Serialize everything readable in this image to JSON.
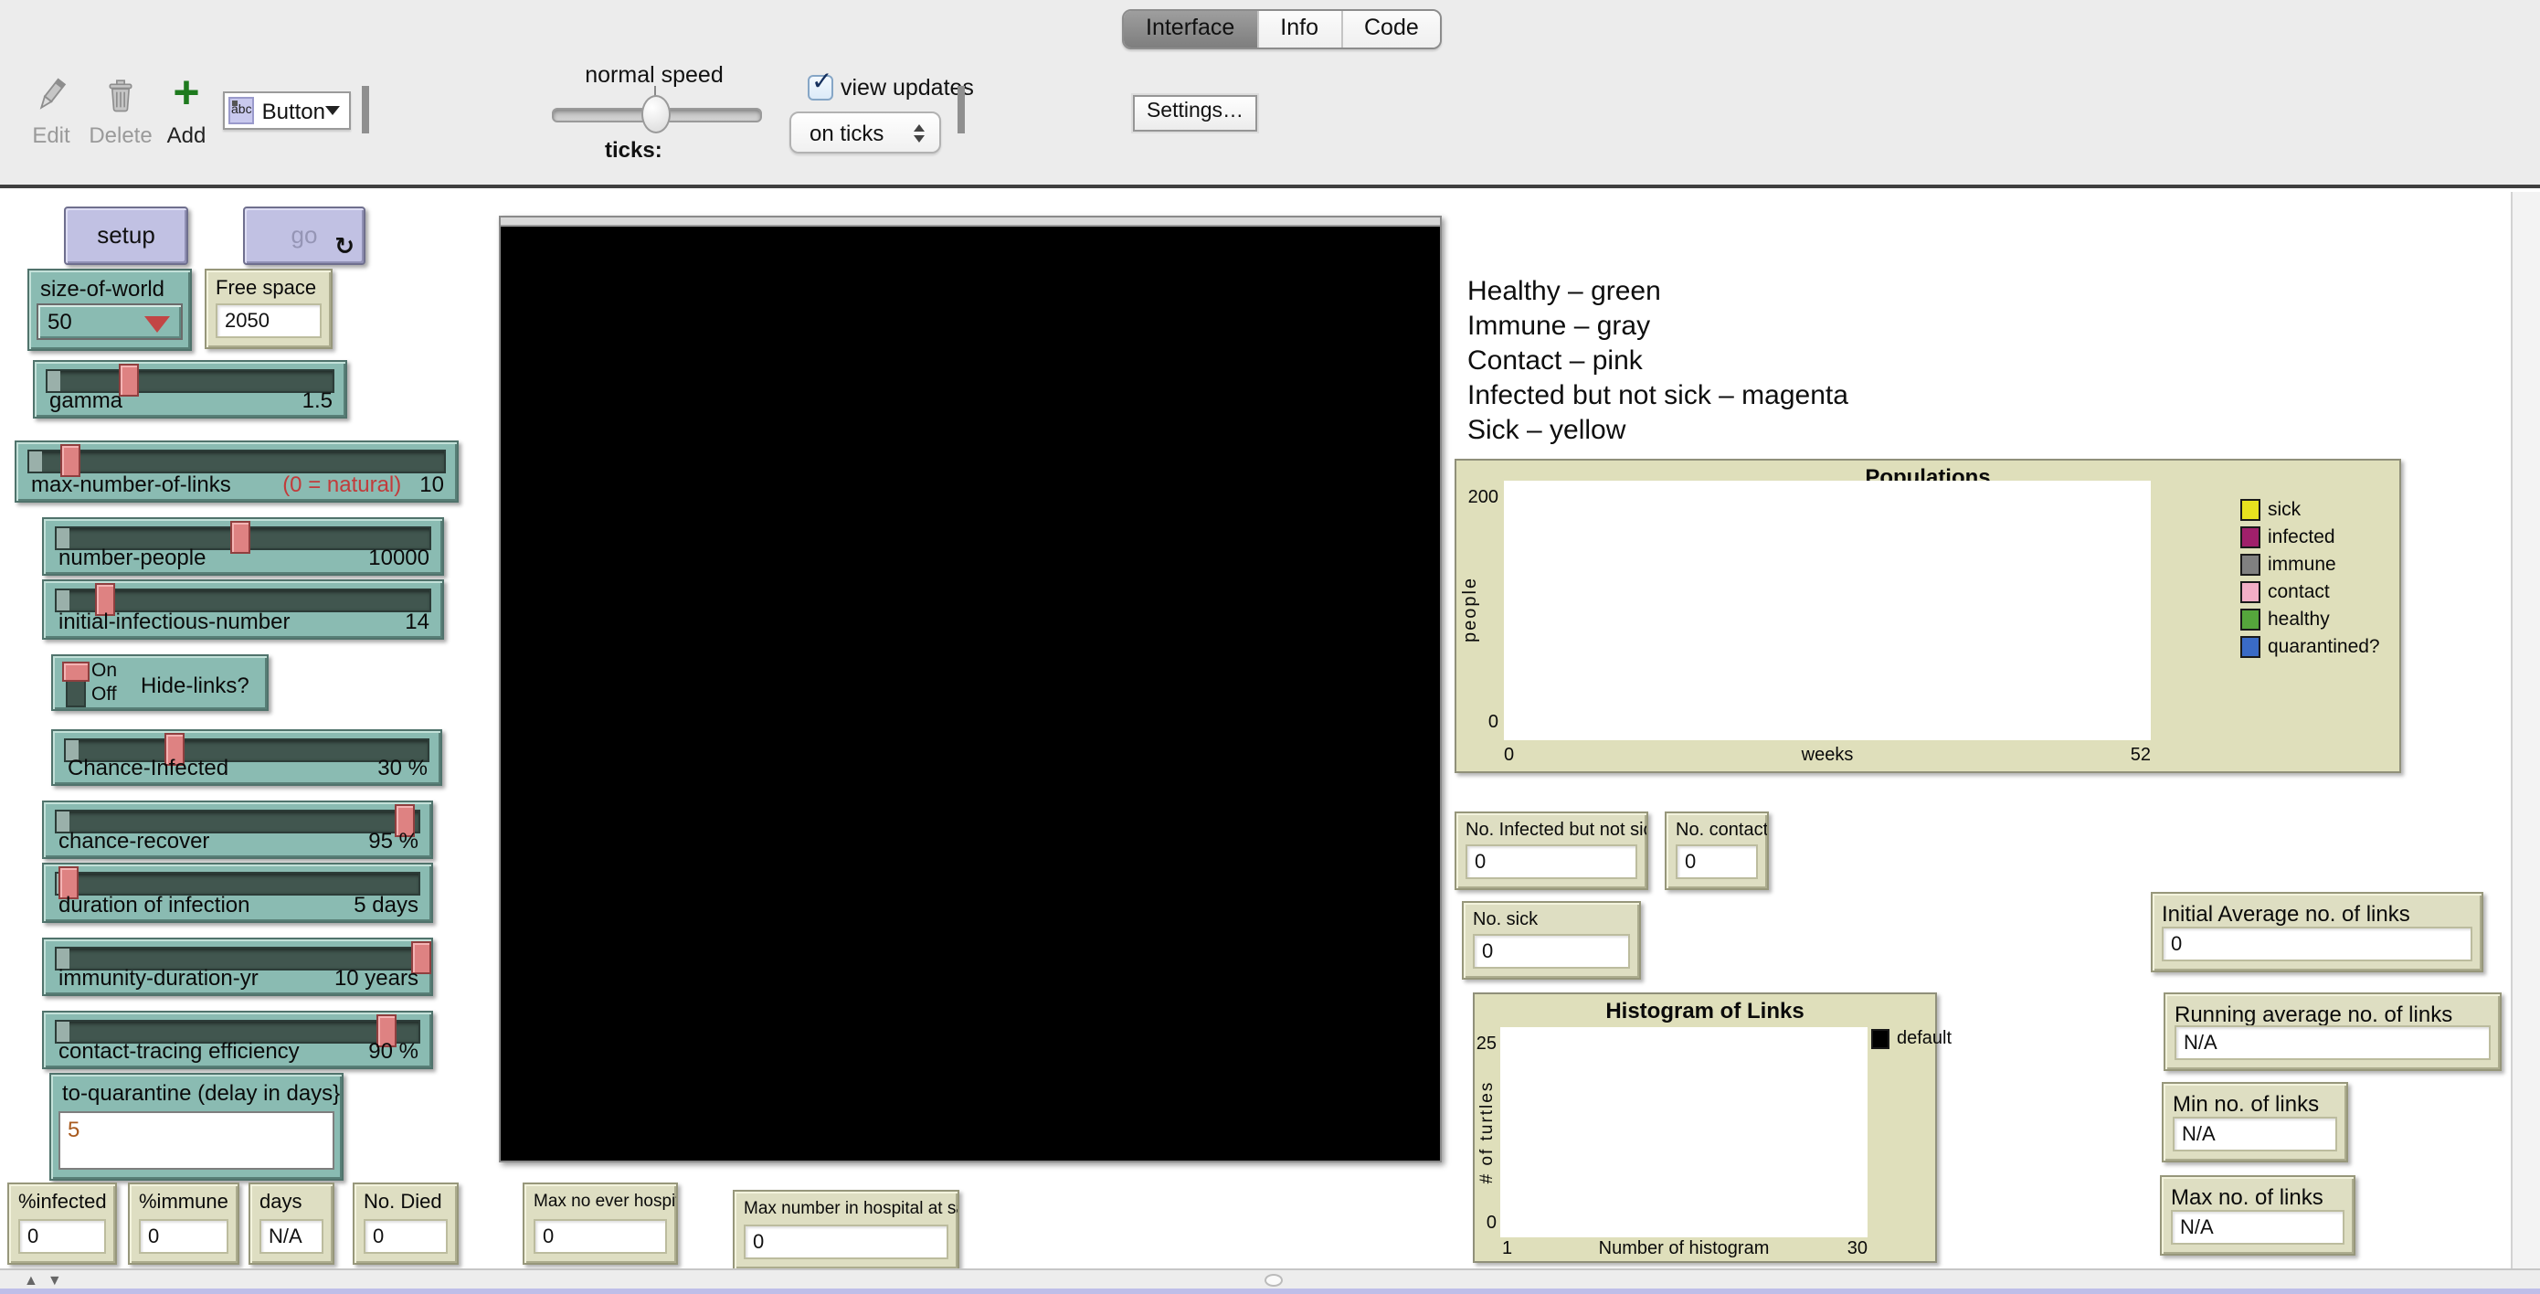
{
  "toolbar": {
    "tabs": [
      {
        "label": "Interface",
        "active": true
      },
      {
        "label": "Info",
        "active": false
      },
      {
        "label": "Code",
        "active": false
      }
    ],
    "edit_label": "Edit",
    "delete_label": "Delete",
    "add_label": "Add",
    "widget_chooser": {
      "icon_label": "abc",
      "value": "Button"
    },
    "speed_label": "normal speed",
    "ticks_label": "ticks:",
    "view_updates_label": "view updates",
    "view_updates_checked": "✓",
    "update_mode": {
      "value": "on ticks"
    },
    "settings_label": "Settings…"
  },
  "buttons": {
    "setup_label": "setup",
    "go_label": "go",
    "forever_glyph": "↻"
  },
  "chooser": {
    "label": "size-of-world",
    "value": "50"
  },
  "monitors_left": [
    {
      "label": "Free space",
      "value": "2050"
    }
  ],
  "sliders": [
    {
      "label": "gamma",
      "extra": "",
      "value": "1.5",
      "pos": 30
    },
    {
      "label": "max-number-of-links",
      "extra": "(0 = natural)",
      "value": "10",
      "pos": 12
    },
    {
      "label": "number-people",
      "extra": "",
      "value": "10000",
      "pos": 49
    },
    {
      "label": "initial-infectious-number",
      "extra": "",
      "value": "14",
      "pos": 15
    },
    {
      "label": "Chance-Infected",
      "extra": "",
      "value": "30 %",
      "pos": 31
    },
    {
      "label": "chance-recover",
      "extra": "",
      "value": "95 %",
      "pos": 93
    },
    {
      "label": "duration of infection",
      "extra": "",
      "value": "5 days",
      "pos": 6
    },
    {
      "label": "immunity-duration-yr",
      "extra": "",
      "value": "10 years",
      "pos": 97
    },
    {
      "label": "contact-tracing efficiency",
      "extra": "",
      "value": "90 %",
      "pos": 88
    }
  ],
  "switch": {
    "label": "Hide-links?",
    "on_label": "On",
    "off_label": "Off",
    "state": "On"
  },
  "input": {
    "label": "to-quarantine (delay in days}",
    "value": "5"
  },
  "notes": {
    "lines": [
      "Healthy – green",
      "Immune – gray",
      "Contact – pink",
      "Infected but not sick – magenta",
      "Sick – yellow"
    ]
  },
  "plots": {
    "populations": {
      "title": "Populations",
      "ylabel": "people",
      "xlabel": "weeks",
      "ymax": "200",
      "ymin": "0",
      "xmin": "0",
      "xmax": "52",
      "legend": [
        {
          "label": "sick",
          "color": "#E8E21F"
        },
        {
          "label": "infected",
          "color": "#A0206B"
        },
        {
          "label": "immune",
          "color": "#808080"
        },
        {
          "label": "contact",
          "color": "#F2AEC6"
        },
        {
          "label": "healthy",
          "color": "#55A63C"
        },
        {
          "label": "quarantined?",
          "color": "#3A6BC6"
        }
      ]
    },
    "histogram": {
      "title": "Histogram of Links",
      "ylabel": "# of turtles",
      "xlabel": "Number of histogram",
      "ymax": "25",
      "ymin": "0",
      "xmin": "1",
      "xmax": "30",
      "legend": [
        {
          "label": "default",
          "color": "#000000"
        }
      ]
    }
  },
  "monitors_right": [
    {
      "label": "No. Infected but not sick",
      "value": "0"
    },
    {
      "label": "No. contacts",
      "value": "0"
    },
    {
      "label": "No. sick",
      "value": "0"
    },
    {
      "label": "Initial Average no. of links",
      "value": "0"
    },
    {
      "label": "Running average no. of links",
      "value": "N/A"
    },
    {
      "label": "Min no. of links",
      "value": "N/A"
    },
    {
      "label": "Max no. of links",
      "value": "N/A"
    }
  ],
  "monitors_bottom": [
    {
      "label": "%infected",
      "value": "0"
    },
    {
      "label": "%immune",
      "value": "0"
    },
    {
      "label": "days",
      "value": "N/A"
    },
    {
      "label": "No. Died",
      "value": "0"
    },
    {
      "label": "Max no ever hospitalised",
      "value": "0"
    },
    {
      "label": "Max number in hospital at same time",
      "value": "0"
    }
  ],
  "colors": {
    "widget_teal": "#8ABBB2",
    "monitor_beige": "#DEDEC2",
    "plot_beige": "#DFDFBB",
    "button_lavender": "#C1C1E3",
    "slider_handle": "#DE8282",
    "accent_red": "#C23B3B"
  }
}
